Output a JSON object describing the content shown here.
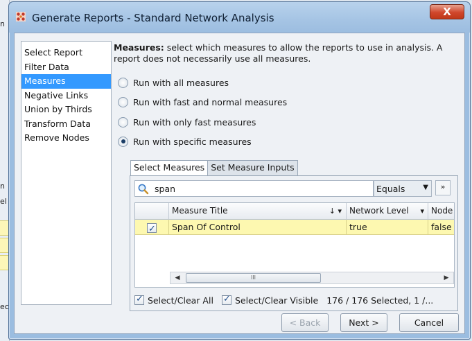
{
  "background_app": {
    "fragments": [
      "n",
      "n",
      "el",
      "ec"
    ]
  },
  "window": {
    "title": "Generate Reports - Standard Network Analysis",
    "close_label": "X"
  },
  "nav": {
    "items": [
      "Select Report",
      "Filter Data",
      "Measures",
      "Negative Links",
      "Union by Thirds",
      "Transform Data",
      "Remove Nodes"
    ],
    "selected": "Measures"
  },
  "description": {
    "heading": "Measures:",
    "text": " select which measures to allow the reports to use in analysis. A report does not necessarily use all measures."
  },
  "options": [
    {
      "label": "Run with all measures",
      "checked": false
    },
    {
      "label": "Run with fast and normal measures",
      "checked": false
    },
    {
      "label": "Run with only fast measures",
      "checked": false
    },
    {
      "label": "Run with specific measures",
      "checked": true
    }
  ],
  "tabs": [
    {
      "label": "Select Measures",
      "active": true
    },
    {
      "label": "Set Measure Inputs",
      "active": false
    }
  ],
  "filter": {
    "search_value": "span",
    "match_mode": "Equals",
    "expand_label": "»"
  },
  "table": {
    "columns": [
      {
        "label": ""
      },
      {
        "label": "Measure Title",
        "sort": "↓ ▾"
      },
      {
        "label": "Network Level",
        "sort": "▾"
      },
      {
        "label": "Node"
      }
    ],
    "rows": [
      {
        "checked": true,
        "title": "Span Of Control",
        "network_level": "true",
        "node": "false"
      }
    ],
    "scroll_thumb_label": "III"
  },
  "selection": {
    "select_all_label": "Select/Clear All",
    "select_visible_label": "Select/Clear Visible",
    "status": "176 / 176 Selected, 1 /..."
  },
  "buttons": {
    "back": "< Back",
    "next": "Next >",
    "cancel": "Cancel"
  },
  "colors": {
    "selection": "#3399ff",
    "row_highlight": "#fdf8b0",
    "title_bar": "#a5c4e4",
    "close_button": "#d0472c"
  }
}
